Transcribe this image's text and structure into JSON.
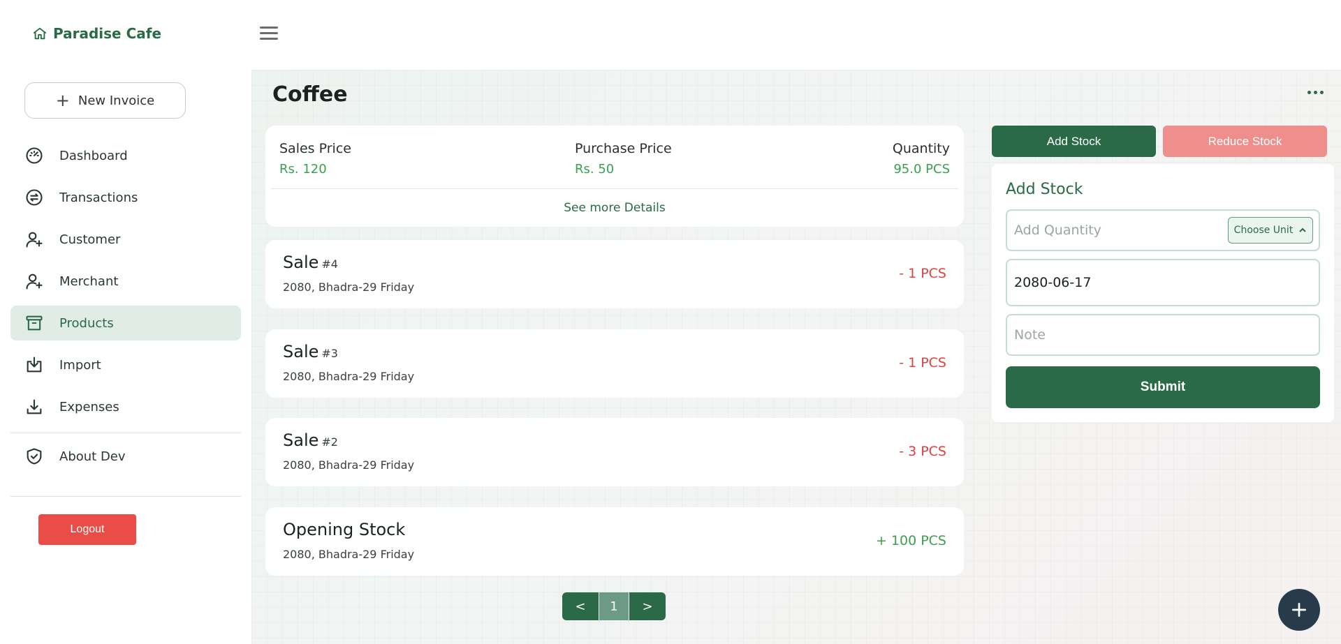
{
  "brand": {
    "name": "Paradise Cafe",
    "icon": "home-icon"
  },
  "sidebar": {
    "new_invoice_label": "New Invoice",
    "items": [
      {
        "label": "Dashboard",
        "icon": "gauge-icon",
        "active": false
      },
      {
        "label": "Transactions",
        "icon": "exchange-icon",
        "active": false
      },
      {
        "label": "Customer",
        "icon": "user-plus-icon",
        "active": false
      },
      {
        "label": "Merchant",
        "icon": "user-plus-icon",
        "active": false
      },
      {
        "label": "Products",
        "icon": "archive-icon",
        "active": true
      },
      {
        "label": "Import",
        "icon": "import-icon",
        "active": false
      },
      {
        "label": "Expenses",
        "icon": "download-icon",
        "active": false
      }
    ],
    "about_label": "About Dev",
    "logout_label": "Logout"
  },
  "page": {
    "title": "Coffee"
  },
  "summary": {
    "sales_price_label": "Sales Price",
    "sales_price_value": "Rs. 120",
    "purchase_price_label": "Purchase Price",
    "purchase_price_value": "Rs. 50",
    "quantity_label": "Quantity",
    "quantity_value": "95.0 PCS",
    "see_more_label": "See more Details"
  },
  "transactions": [
    {
      "title": "Sale",
      "number": "#4",
      "date": "2080, Bhadra-29 Friday",
      "qty": "- 1 PCS",
      "direction": "negative"
    },
    {
      "title": "Sale",
      "number": "#3",
      "date": "2080, Bhadra-29 Friday",
      "qty": "- 1 PCS",
      "direction": "negative"
    },
    {
      "title": "Sale",
      "number": "#2",
      "date": "2080, Bhadra-29 Friday",
      "qty": "- 3 PCS",
      "direction": "negative"
    },
    {
      "title": "Opening Stock",
      "number": "",
      "date": "2080, Bhadra-29 Friday",
      "qty": "+ 100 PCS",
      "direction": "positive"
    }
  ],
  "pagination": {
    "prev": "<",
    "current": "1",
    "next": ">"
  },
  "stock_actions": {
    "add_label": "Add Stock",
    "reduce_label": "Reduce Stock"
  },
  "stock_form": {
    "title": "Add Stock",
    "quantity_placeholder": "Add Quantity",
    "unit_label": "Choose Unit",
    "date_value": "2080-06-17",
    "note_placeholder": "Note",
    "submit_label": "Submit"
  },
  "colors": {
    "primary": "#2a6a47",
    "danger": "#ea4d48",
    "reduce": "#ef8f8b",
    "positive": "#3aa04f",
    "negative": "#e0413c",
    "fab": "#283b4a"
  }
}
